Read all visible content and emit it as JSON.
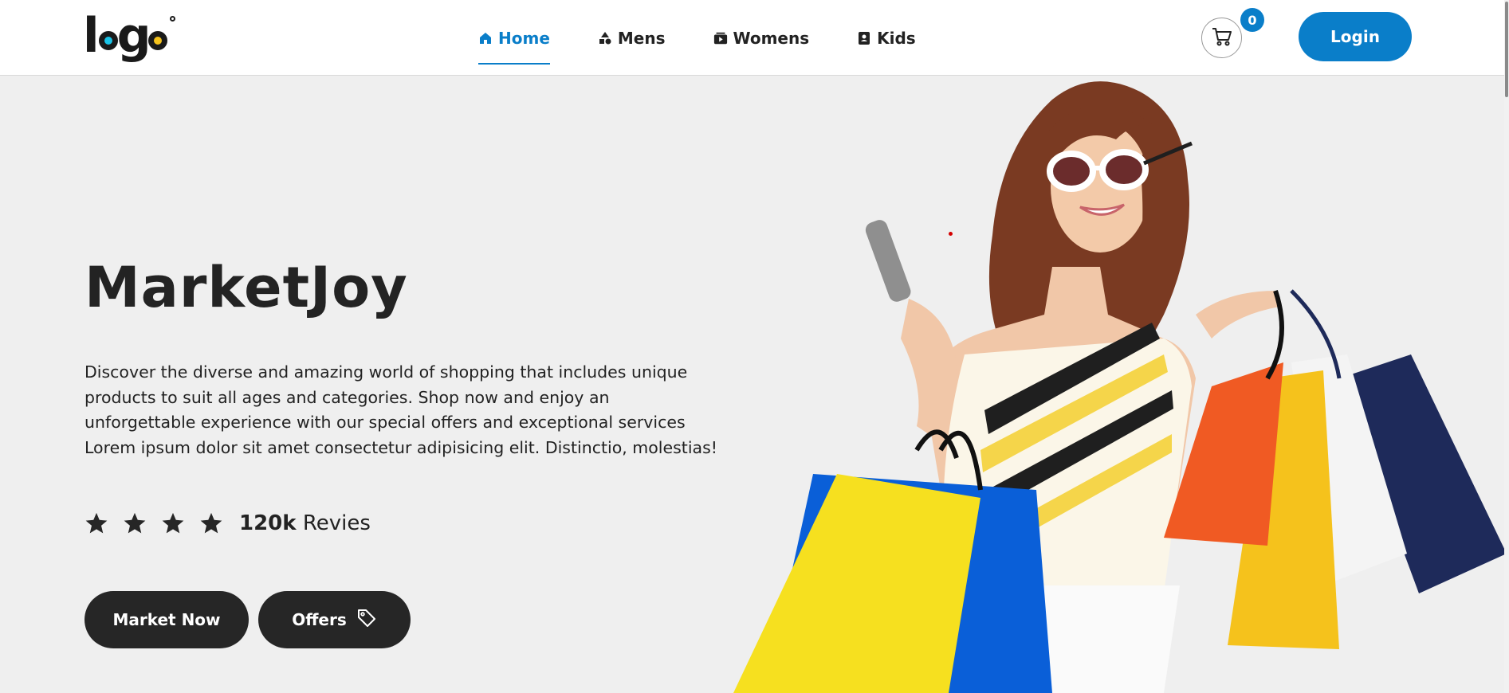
{
  "header": {
    "logo_text": "logo",
    "nav": [
      {
        "label": "Home",
        "icon": "home-icon",
        "active": true
      },
      {
        "label": "Mens",
        "icon": "shapes-icon",
        "active": false
      },
      {
        "label": "Womens",
        "icon": "video-library-icon",
        "active": false
      },
      {
        "label": "Kids",
        "icon": "contact-card-icon",
        "active": false
      }
    ],
    "cart_count": "0",
    "login_label": "Login"
  },
  "hero": {
    "title": "MarketJoy",
    "description": "Discover the diverse and amazing world of shopping that includes unique products to suit all ages and categories. Shop now and enjoy an unforgettable experience with our special offers and exceptional services Lorem ipsum dolor sit amet consectetur adipisicing elit. Distinctio, molestias!",
    "rating_stars": 4,
    "reviews_count": "120k",
    "reviews_label": "Revies",
    "primary_button": "Market Now",
    "secondary_button": "Offers"
  },
  "colors": {
    "accent": "#0a7ec9",
    "dark_button": "#262626",
    "hero_bg": "#efefef"
  }
}
